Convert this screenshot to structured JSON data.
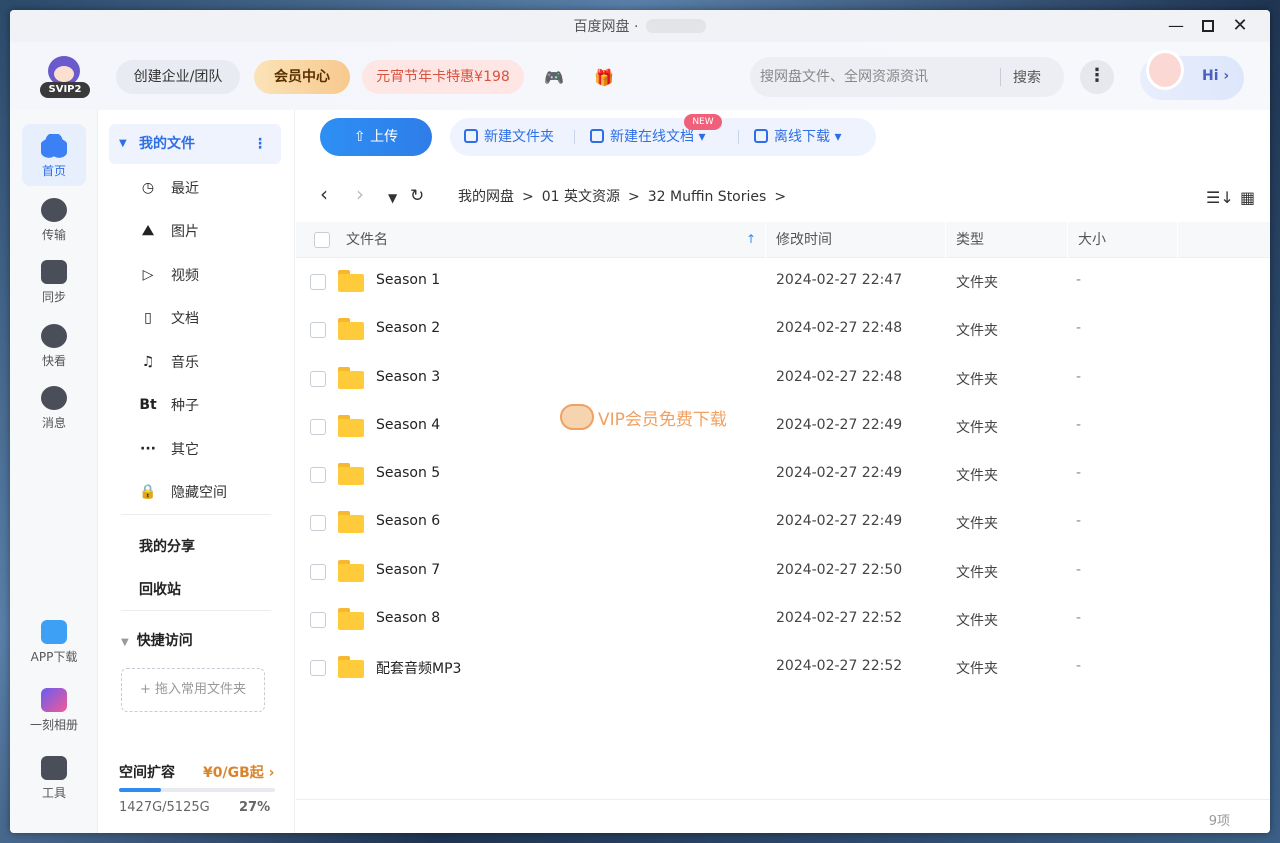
{
  "window": {
    "title": "百度网盘 ·"
  },
  "header": {
    "badge": "SVIP2",
    "team_label": "创建企业/团队",
    "vip_label": "会员中心",
    "promo_label": "元宵节年卡特惠¥198",
    "search_placeholder": "搜网盘文件、全网资源资讯",
    "search_btn": "搜索",
    "hi_label": "Hi ›"
  },
  "rail": [
    {
      "label": "首页",
      "icon": "home-icon"
    },
    {
      "label": "传输",
      "icon": "transfer-icon"
    },
    {
      "label": "同步",
      "icon": "sync-icon"
    },
    {
      "label": "快看",
      "icon": "watch-icon"
    },
    {
      "label": "消息",
      "icon": "message-icon"
    },
    {
      "label": "APP下载",
      "icon": "app-download-icon"
    },
    {
      "label": "一刻相册",
      "icon": "album-icon"
    },
    {
      "label": "工具",
      "icon": "tools-icon"
    }
  ],
  "sidebar": {
    "my_files": "我的文件",
    "items": [
      {
        "label": "最近",
        "icon": "◷"
      },
      {
        "label": "图片",
        "icon": "⛰"
      },
      {
        "label": "视频",
        "icon": "▷"
      },
      {
        "label": "文档",
        "icon": "▯"
      },
      {
        "label": "音乐",
        "icon": "♫"
      },
      {
        "label": "种子",
        "icon": "Bt"
      },
      {
        "label": "其它",
        "icon": "···"
      },
      {
        "label": "隐藏空间",
        "icon": "🔒"
      }
    ],
    "my_share": "我的分享",
    "recycle": "回收站",
    "quick_access": "快捷访问",
    "drop_hint": "+ 拖入常用文件夹",
    "capacity": {
      "title": "空间扩容",
      "price": "¥0/GB起 ›",
      "used": "1427G/5125G",
      "percent_label": "27%",
      "percent": 0.27
    }
  },
  "toolbar": {
    "upload": "上传",
    "new_folder": "新建文件夹",
    "new_doc": "新建在线文档 ▾",
    "new_badge": "NEW",
    "offline": "离线下载 ▾"
  },
  "breadcrumb": [
    "我的网盘",
    "01 英文资源",
    "32 Muffin Stories"
  ],
  "table": {
    "headers": {
      "name": "文件名",
      "modified": "修改时间",
      "type": "类型",
      "size": "大小"
    },
    "rows": [
      {
        "name": "Season 1",
        "modified": "2024-02-27 22:47",
        "type": "文件夹",
        "size": "-"
      },
      {
        "name": "Season 2",
        "modified": "2024-02-27 22:48",
        "type": "文件夹",
        "size": "-"
      },
      {
        "name": "Season 3",
        "modified": "2024-02-27 22:48",
        "type": "文件夹",
        "size": "-"
      },
      {
        "name": "Season 4",
        "modified": "2024-02-27 22:49",
        "type": "文件夹",
        "size": "-"
      },
      {
        "name": "Season 5",
        "modified": "2024-02-27 22:49",
        "type": "文件夹",
        "size": "-"
      },
      {
        "name": "Season 6",
        "modified": "2024-02-27 22:49",
        "type": "文件夹",
        "size": "-"
      },
      {
        "name": "Season 7",
        "modified": "2024-02-27 22:50",
        "type": "文件夹",
        "size": "-"
      },
      {
        "name": "Season 8",
        "modified": "2024-02-27 22:52",
        "type": "文件夹",
        "size": "-"
      },
      {
        "name": "配套音频MP3",
        "modified": "2024-02-27 22:52",
        "type": "文件夹",
        "size": "-"
      }
    ]
  },
  "watermark": "VIP会员免费下载",
  "footer": {
    "count": "9项"
  },
  "colors": {
    "accent": "#2f6fe6",
    "upload": "#2d8ff4",
    "vip": "#f7c98d",
    "promo_text": "#d8533f",
    "folder": "#ffcb3a"
  }
}
